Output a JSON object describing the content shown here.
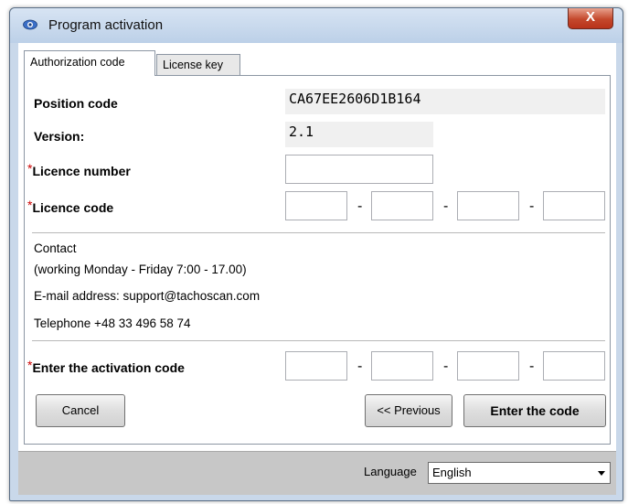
{
  "window": {
    "title": "Program activation",
    "close_label": "X"
  },
  "tabs": [
    {
      "label": "Authorization code",
      "active": true
    },
    {
      "label": "License key",
      "active": false
    }
  ],
  "form": {
    "position_code_label": "Position code",
    "position_code_value": "CA67EE2606D1B164",
    "version_label": "Version:",
    "version_value": "2.1",
    "required_mark": "*",
    "licence_number_label": "Licence number",
    "licence_number_value": "",
    "licence_code_label": "Licence code",
    "licence_code_parts": [
      "",
      "",
      "",
      ""
    ],
    "dash": "-",
    "activation_code_label": "Enter the activation code",
    "activation_code_parts": [
      "",
      "",
      "",
      ""
    ]
  },
  "contact": {
    "heading": "Contact",
    "hours": "(working Monday - Friday 7:00 - 17.00)",
    "email_line": "E-mail address:  support@tachoscan.com",
    "phone_line": "Telephone  +48 33 496 58 74"
  },
  "buttons": {
    "cancel": "Cancel",
    "previous": "<< Previous",
    "enter_code": "Enter the code"
  },
  "footer": {
    "language_label": "Language",
    "language_value": "English"
  },
  "colors": {
    "required": "#cc0000",
    "title_bar": "#bcd0e8",
    "close_button": "#c4482c",
    "footer": "#c7c7c7"
  }
}
